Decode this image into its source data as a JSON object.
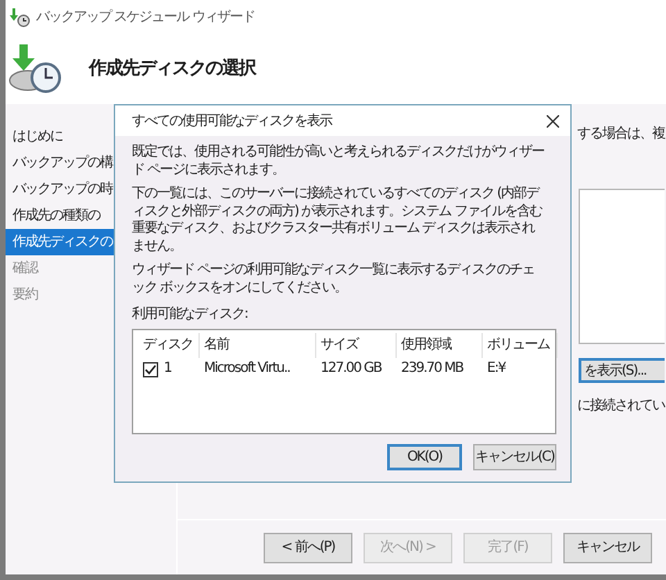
{
  "window": {
    "title": "バックアップ スケジュール ウィザード"
  },
  "page_title": "作成先ディスクの選択",
  "steps": [
    {
      "label": "はじめに",
      "selected": false,
      "disabled": false
    },
    {
      "label": "バックアップの構",
      "selected": false,
      "disabled": false
    },
    {
      "label": "バックアップの時",
      "selected": false,
      "disabled": false
    },
    {
      "label": "作成先の種類の",
      "selected": false,
      "disabled": false
    },
    {
      "label": "作成先ディスクの",
      "selected": true,
      "disabled": false
    },
    {
      "label": "確認",
      "selected": false,
      "disabled": true
    },
    {
      "label": "要約",
      "selected": false,
      "disabled": true
    }
  ],
  "page_fragments": {
    "text_1": "する場合は、複",
    "show_button": "を表示(S)...",
    "text_2": "に接続されてい"
  },
  "footer_buttons": [
    {
      "label": "< 前へ(P)",
      "disabled": false
    },
    {
      "label": "次へ(N) >",
      "disabled": true
    },
    {
      "label": "完了(F)",
      "disabled": true
    },
    {
      "label": "キャンセル",
      "disabled": false
    }
  ],
  "dialog": {
    "title": "すべての使用可能なディスクを表示",
    "paragraphs": [
      "既定では、使用される可能性が高いと考えられるディスクだけがウィザード ページに表示されます。",
      "下の一覧には、このサーバーに接続されているすべてのディスク (内部ディスクと外部ディスクの両方) が表示されます。システム ファイルを含む重要なディスク、およびクラスター共有ボリューム ディスクは表示されません。",
      "ウィザード ページの利用可能なディスク一覧に表示するディスクのチェック ボックスをオンにしてください。"
    ],
    "list_label": "利用可能なディスク:",
    "columns": [
      "ディスク",
      "名前",
      "サイズ",
      "使用領域",
      "ボリューム"
    ],
    "rows": [
      {
        "checked": true,
        "cells": [
          "1",
          "Microsoft Virtu..",
          "127.00 GB",
          "239.70 MB",
          "E:¥"
        ]
      }
    ],
    "buttons": [
      {
        "label": "OK(O)",
        "default": true
      },
      {
        "label": "キャンセル(C)",
        "default": false
      }
    ]
  }
}
